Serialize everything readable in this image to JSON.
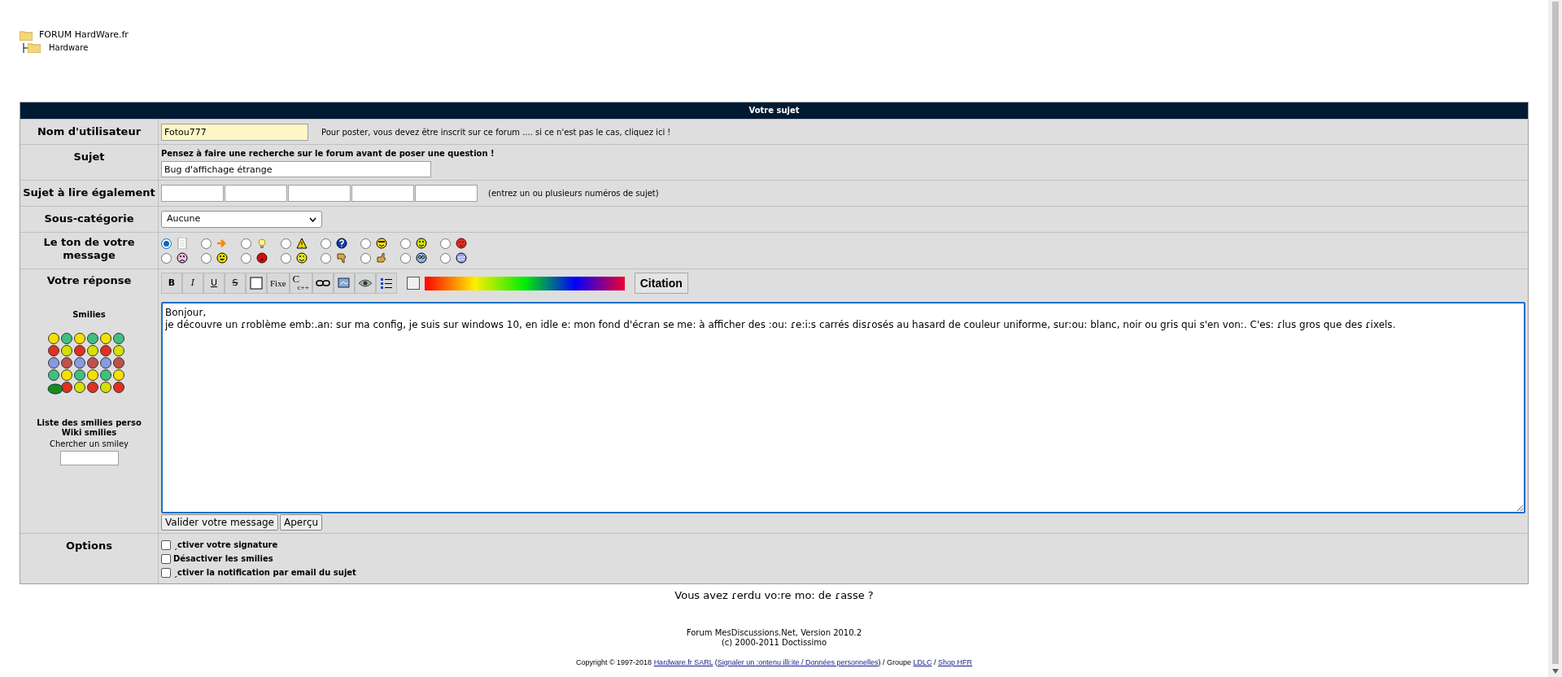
{
  "breadcrumb": [
    {
      "label": "FORUM HardWare.fr",
      "children": [
        {
          "label": "Hardware"
        }
      ]
    }
  ],
  "form": {
    "title": "Votre sujet",
    "username": {
      "label": "Nom d'utilisateur",
      "value": "Fotou777",
      "note": "Pour poster, vous devez être inscrit sur ce forum .... si ce n'est pas le cas, cliquez ici !"
    },
    "subject": {
      "label": "Sujet",
      "hint": "Pensez à faire une recherche sur le forum avant de poser une question !",
      "value": "Bug d'affichage étrange"
    },
    "related": {
      "label": "Sujet à lire également",
      "note": "(entrez un ou plusieurs numéros de sujet)"
    },
    "subcategory": {
      "label": "Sous-catégorie",
      "value": "Aucune"
    },
    "tone": {
      "label": "Le ton de votre message",
      "options": [
        {
          "selected": true
        },
        {
          "selected": false
        },
        {
          "selected": false
        },
        {
          "selected": false
        },
        {
          "selected": false
        },
        {
          "selected": false
        },
        {
          "selected": false
        },
        {
          "selected": false
        },
        {
          "selected": false
        },
        {
          "selected": false
        },
        {
          "selected": false
        },
        {
          "selected": false
        },
        {
          "selected": false
        },
        {
          "selected": false
        },
        {
          "selected": false
        },
        {
          "selected": false
        }
      ]
    },
    "reply": {
      "label": "Votre réponse",
      "toolbar": [
        {
          "kind": "bold",
          "label": "B"
        },
        {
          "kind": "italic",
          "label": "I"
        },
        {
          "kind": "underline",
          "label": "U"
        },
        {
          "kind": "strike",
          "label": "S"
        },
        {
          "kind": "square"
        },
        {
          "kind": "fixed",
          "label": "Fixe"
        },
        {
          "kind": "code",
          "label": "C",
          "sub": "c++"
        },
        {
          "kind": "link"
        },
        {
          "kind": "image"
        },
        {
          "kind": "eye"
        },
        {
          "kind": "list"
        }
      ],
      "quote_button": "Citation",
      "smilies_title": "Smilies",
      "smilies_links": [
        "Liste des smilies perso",
        "Wiki smilies"
      ],
      "smiley_search_label": "Chercher un smiley",
      "message": "Bonjour,\nje découvre un ɾroblème emb:.an: sur ma config, je suis sur windows 10, en idle e: mon fond d'écran se me: à afficher des :ou: ɾe:i:s carrés disɾosés au hasard de couleur uniforme, sur:ou: blanc, noir ou gris qui s'en von:. C'es: ɾlus gros que des ɾixels.",
      "buttons": [
        "Valider votre message",
        "Aperçu"
      ]
    },
    "options": {
      "label": "Options",
      "items": [
        {
          "label": "ˏctiver votre signature",
          "checked": false
        },
        {
          "label": "Désactiver les smilies",
          "checked": false
        },
        {
          "label": "ˏctiver la notification par email du sujet",
          "checked": false
        }
      ]
    }
  },
  "lost_password": "Vous avez ɾerdu vo:re mo: de ɾasse ?",
  "footer": {
    "lines": [
      "Forum MesDiscussions.Net, Version 2010.2",
      "(c) 2000-2011 Doctissimo"
    ],
    "copyright": [
      {
        "kind": "text",
        "text": "Copyright © 1997-2018 "
      },
      {
        "kind": "link",
        "text": "Hardware.fr SARL"
      },
      {
        "kind": "text",
        "text": " ("
      },
      {
        "kind": "link",
        "text": "Signaler un :ontenu illi:ite / Données personnelles"
      },
      {
        "kind": "text",
        "text": ") / Groupe "
      },
      {
        "kind": "link",
        "text": "LDLC"
      },
      {
        "kind": "text",
        "text": " / "
      },
      {
        "kind": "link",
        "text": "Shop HFR"
      }
    ]
  }
}
